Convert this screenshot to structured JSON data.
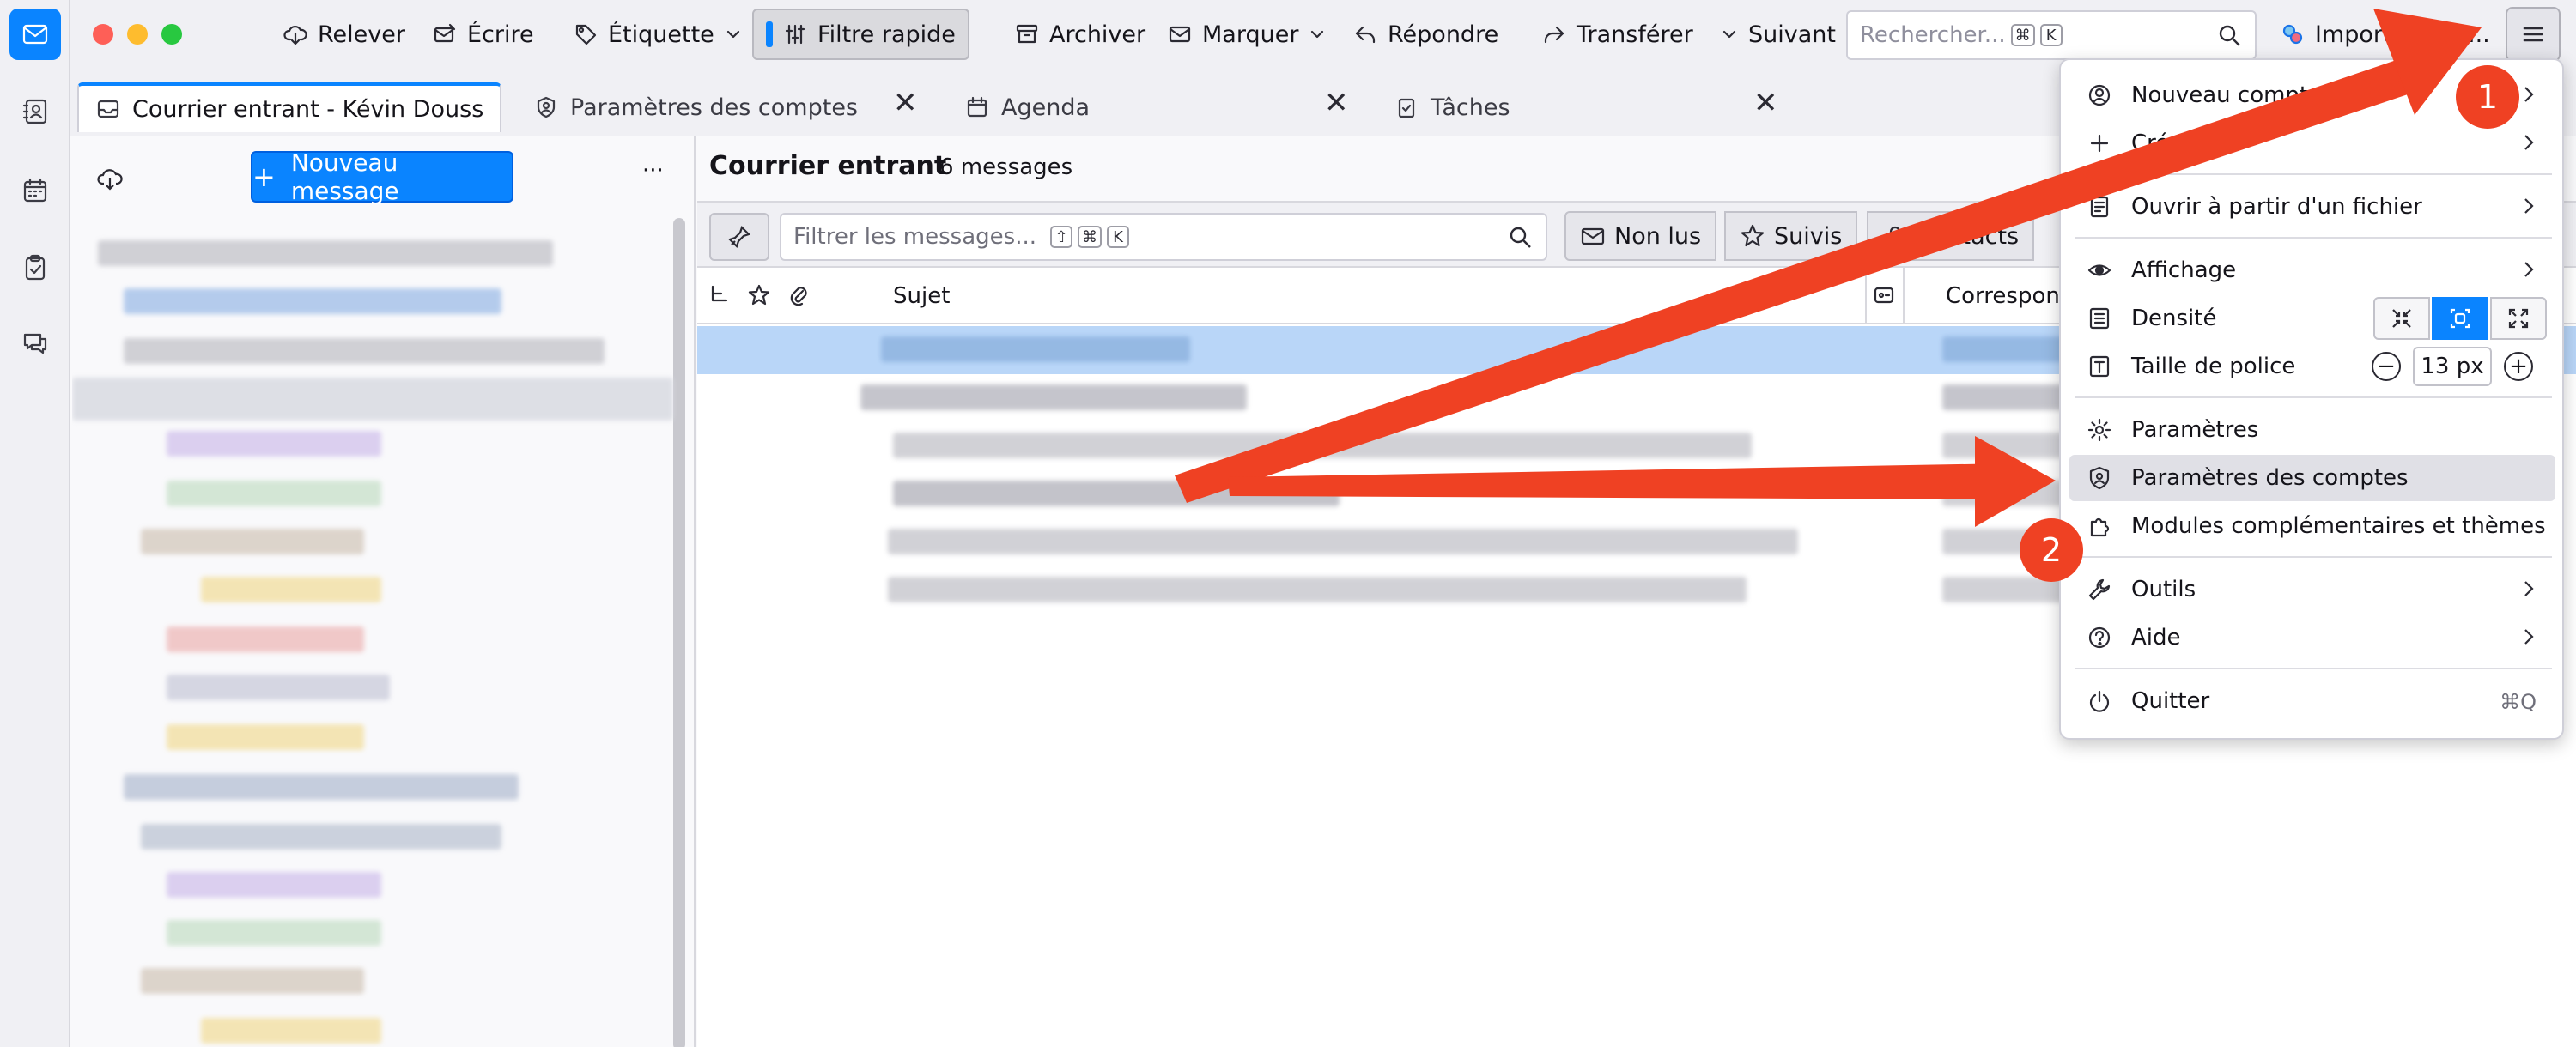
{
  "toolbar": {
    "get_messages": "Relever",
    "write": "Écrire",
    "tag": "Étiquette",
    "quick_filter": "Filtre rapide",
    "archive": "Archiver",
    "mark": "Marquer",
    "reply": "Répondre",
    "forward": "Transférer",
    "next": "Suivant",
    "search_placeholder": "Rechercher...",
    "search_kbd_1": "⌘",
    "search_kbd_2": "K",
    "addon": "ImportExport..."
  },
  "tabs": [
    {
      "label": "Courrier entrant - Kévin Doussaint"
    },
    {
      "label": "Paramètres des comptes"
    },
    {
      "label": "Agenda"
    },
    {
      "label": "Tâches"
    }
  ],
  "tab_close": "✕",
  "folder_pane": {
    "new_message": "Nouveau message",
    "more": "···"
  },
  "message_pane": {
    "folder_name": "Courrier entrant",
    "count": "6 messages",
    "filter_placeholder": "Filtrer les messages...",
    "filter_kbd_1": "⇧",
    "filter_kbd_2": "⌘",
    "filter_kbd_3": "K",
    "unread": "Non lus",
    "starred": "Suivis",
    "contacts": "Contacts",
    "col_subject": "Sujet",
    "col_correspondent": "Correspondant"
  },
  "app_menu": {
    "new_account": "Nouveau compte",
    "create": "Créer",
    "open_file": "Ouvrir à partir d'un fichier",
    "view": "Affichage",
    "density": "Densité",
    "font_size": "Taille de police",
    "font_size_value": "13 px",
    "minus": "−",
    "plus": "+",
    "settings": "Paramètres",
    "account_settings": "Paramètres des comptes",
    "addons": "Modules complémentaires et thèmes",
    "tools": "Outils",
    "help": "Aide",
    "quit": "Quitter",
    "quit_shortcut": "⌘Q"
  },
  "annotations": {
    "step1": "1",
    "step2": "2",
    "color": "#ef4123"
  },
  "colors": {
    "accent": "#0a84ff",
    "selection": "#b9d6f8"
  }
}
